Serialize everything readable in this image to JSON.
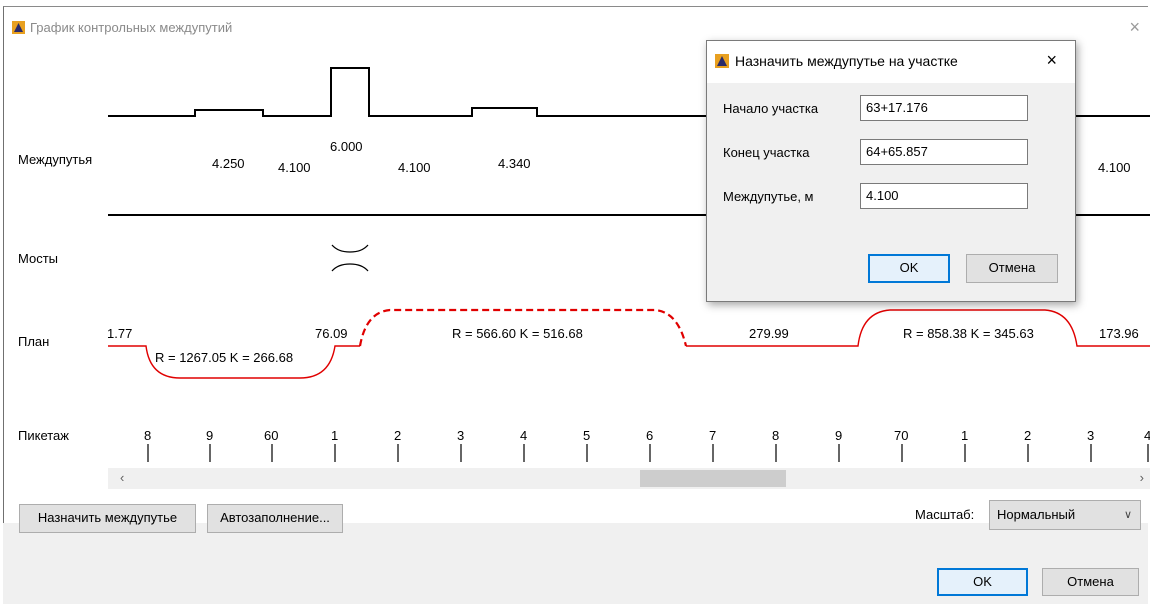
{
  "window": {
    "title": "График контрольных междупутий",
    "close": "×"
  },
  "rows": {
    "mezhdu": "Междупутья",
    "mosty": "Мосты",
    "plan": "План",
    "piket": "Пикетаж"
  },
  "mezhdu_values": [
    "4.250",
    "4.100",
    "6.000",
    "4.100",
    "4.340",
    "4.100"
  ],
  "plan_labels": [
    "1.77",
    "R = 1267.05 K = 266.68",
    "76.09",
    "R = 566.60 K = 516.68",
    "279.99",
    "R = 858.38 K = 345.63",
    "173.96"
  ],
  "piket_ticks": [
    "8",
    "9",
    "60",
    "1",
    "2",
    "3",
    "4",
    "5",
    "6",
    "7",
    "8",
    "9",
    "70",
    "1",
    "2",
    "3",
    "4"
  ],
  "scrollbar": {
    "left": "‹",
    "right": "›"
  },
  "buttons": {
    "assign": "Назначить междупутье",
    "autofill": "Автозаполнение...",
    "ok": "OK",
    "cancel": "Отмена"
  },
  "scale": {
    "label": "Масштаб:",
    "value": "Нормальный"
  },
  "dialog": {
    "title": "Назначить междупутье на участке",
    "close": "×",
    "start_label": "Начало участка",
    "start_value": "63+17.176",
    "end_label": "Конец участка",
    "end_value": "64+65.857",
    "width_label": "Междупутье, м",
    "width_value": "4.100",
    "ok": "OK",
    "cancel": "Отмена"
  },
  "colors": {
    "plan_line": "#e00000",
    "accent": "#0078d7"
  }
}
